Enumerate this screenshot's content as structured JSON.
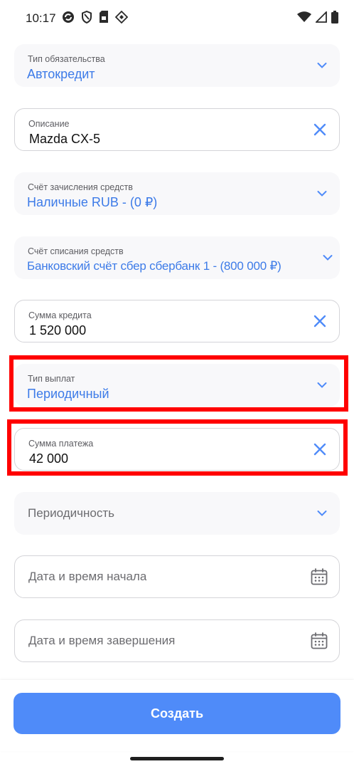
{
  "status_bar": {
    "time": "10:17",
    "left_icons": [
      "sync-icon",
      "shield-icon",
      "sim-card-icon",
      "diamond-icon"
    ],
    "right_icons": [
      "wifi-icon",
      "signal-icon",
      "battery-icon"
    ]
  },
  "fields": {
    "obligation_type": {
      "label": "Тип обязательства",
      "value": "Автокредит"
    },
    "description": {
      "label": "Описание",
      "value": "Mazda CX-5"
    },
    "credit_account": {
      "label": "Счёт зачисления средств",
      "value": "Наличные RUB - (0 ₽)"
    },
    "debit_account": {
      "label": "Счёт списания средств",
      "value": "Банковский счёт сбер сбербанк 1 - (800 000 ₽)"
    },
    "loan_amount": {
      "label": "Сумма кредита",
      "value": "1 520 000"
    },
    "payment_type": {
      "label": "Тип выплат",
      "value": "Периодичный"
    },
    "payment_amount": {
      "label": "Сумма платежа",
      "value": "42 000"
    },
    "periodicity": {
      "placeholder": "Периодичность"
    },
    "start_datetime": {
      "placeholder": "Дата и время начала"
    },
    "end_datetime": {
      "placeholder": "Дата и время завершения"
    }
  },
  "actions": {
    "create_label": "Создать"
  },
  "colors": {
    "accent": "#4f8bf9",
    "value_blue": "#3d7be8",
    "highlight": "#ff0000"
  }
}
